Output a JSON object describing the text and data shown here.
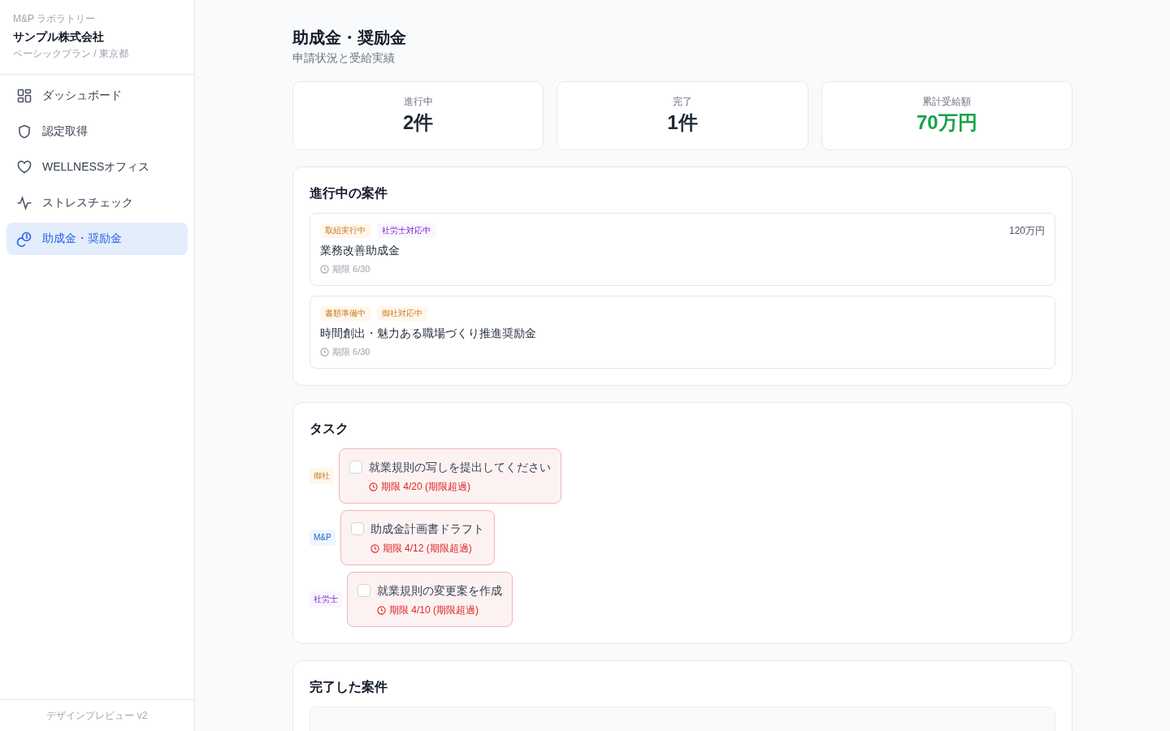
{
  "sidebar": {
    "brand": "M&P ラボラトリー",
    "company": "サンプル株式会社",
    "plan": "ベーシックプラン / 東京都",
    "items": [
      {
        "label": "ダッシュボード",
        "selected": false
      },
      {
        "label": "認定取得",
        "selected": false
      },
      {
        "label": "WELLNESSオフィス",
        "selected": false
      },
      {
        "label": "ストレスチェック",
        "selected": false
      },
      {
        "label": "助成金・奨励金",
        "selected": true
      }
    ],
    "footer": "デザインプレビュー v2"
  },
  "header": {
    "title": "助成金・奨励金",
    "subtitle": "申請状況と受給実績"
  },
  "stats": [
    {
      "label": "進行中",
      "value": "2件",
      "color": "#1f2937"
    },
    {
      "label": "完了",
      "value": "1件",
      "color": "#1f2937"
    },
    {
      "label": "累計受給額",
      "value": "70万円",
      "color": "#16a34a"
    }
  ],
  "in_progress": {
    "title": "進行中の案件",
    "cases": [
      {
        "tags": [
          {
            "label": "取組実行中",
            "color": "#fff7ed"
          },
          {
            "label": "社労士対応中",
            "color": "#faf5ff"
          }
        ],
        "name": "業務改善助成金",
        "deadline": "期限 6/30",
        "amount": "120万円"
      },
      {
        "tags": [
          {
            "label": "書類準備中",
            "color": "#fff7ed"
          },
          {
            "label": "御社対応中",
            "color": "#fff7ed"
          }
        ],
        "name": "時間創出・魅力ある職場づくり推進奨励金",
        "deadline": "期限 6/30"
      }
    ]
  },
  "tasks": {
    "title": "タスク",
    "items": [
      {
        "owner": "御社",
        "color": "#fff7ed",
        "label": "就業規則の写しを提出してください",
        "checked": false,
        "overdue": true,
        "deadline": "期限 4/20 (期限超過)"
      },
      {
        "owner": "M&P",
        "color": "#eff6ff",
        "label": "助成金計画書ドラフト",
        "checked": false,
        "overdue": true,
        "deadline": "期限 4/12 (期限超過)"
      },
      {
        "owner": "社労士",
        "color": "#faf5ff",
        "label": "就業規則の変更案を作成",
        "checked": false,
        "overdue": true,
        "deadline": "期限 4/10 (期限超過)"
      }
    ]
  },
  "completed": {
    "title": "完了した案件"
  }
}
